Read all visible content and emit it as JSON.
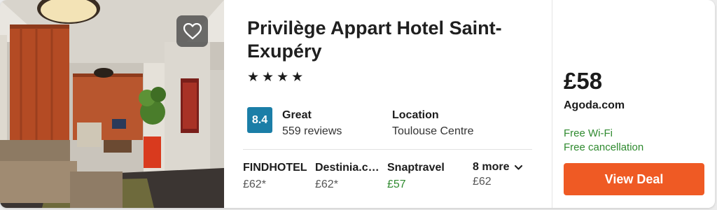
{
  "hotel": {
    "name": "Privilège Appart Hotel Saint-Exupéry",
    "star_count": 4,
    "star_glyph": "★"
  },
  "rating": {
    "score": "8.4",
    "label": "Great",
    "reviews": "559 reviews",
    "badge_color": "#1b7ea7"
  },
  "location": {
    "label": "Location",
    "value": "Toulouse Centre"
  },
  "offers": [
    {
      "name": "FINDHOTEL",
      "price": "£62*",
      "highlight": false
    },
    {
      "name": "Destinia.com",
      "price": "£62*",
      "highlight": false
    },
    {
      "name": "Snaptravel",
      "price": "£57",
      "highlight": true
    }
  ],
  "more": {
    "label": "8 more",
    "price": "£62"
  },
  "deal": {
    "price": "£58",
    "provider": "Agoda.com",
    "amenities": [
      "Free Wi-Fi",
      "Free cancellation"
    ],
    "button_label": "View Deal",
    "button_color": "#ef5a24",
    "amenity_color": "#2f8a2f"
  },
  "icons": {
    "favorite": "heart-outline-icon",
    "more": "chevron-down-icon"
  }
}
